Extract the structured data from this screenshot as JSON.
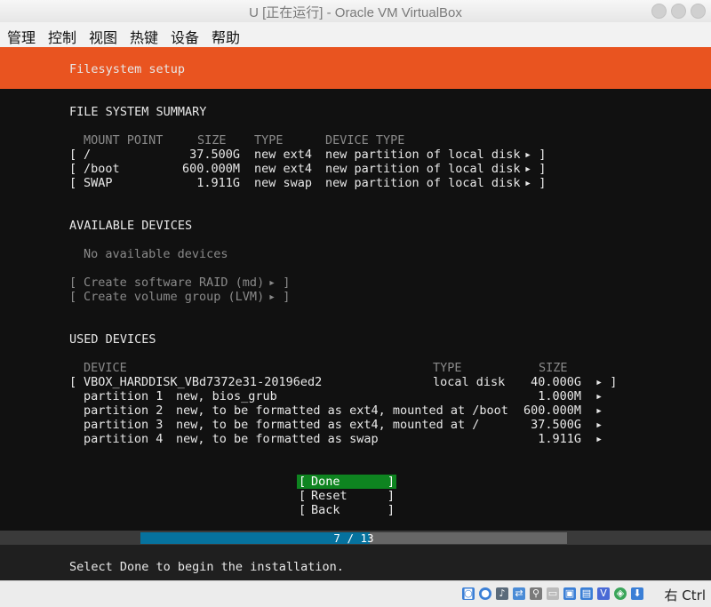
{
  "window": {
    "title": "U [正在运行] - Oracle VM VirtualBox"
  },
  "menubar": {
    "items": [
      "管理",
      "控制",
      "视图",
      "热键",
      "设备",
      "帮助"
    ]
  },
  "installer": {
    "header": "Filesystem setup",
    "summary": {
      "heading": "FILE SYSTEM SUMMARY",
      "columns": [
        "MOUNT POINT",
        "SIZE",
        "TYPE",
        "DEVICE TYPE"
      ],
      "rows": [
        {
          "mount": "/",
          "size": "37.500G",
          "type": "new ext4",
          "device_type": "new partition of local disk"
        },
        {
          "mount": "/boot",
          "size": "600.000M",
          "type": "new ext4",
          "device_type": "new partition of local disk"
        },
        {
          "mount": "SWAP",
          "size": "1.911G",
          "type": "new swap",
          "device_type": "new partition of local disk"
        }
      ]
    },
    "available": {
      "heading": "AVAILABLE DEVICES",
      "empty_text": "No available devices",
      "actions": [
        "Create software RAID (md)",
        "Create volume group (LVM)"
      ]
    },
    "used": {
      "heading": "USED DEVICES",
      "columns": [
        "DEVICE",
        "TYPE",
        "SIZE"
      ],
      "disk": {
        "name": "VBOX_HARDDISK_VBd7372e31-20196ed2",
        "type": "local disk",
        "size": "40.000G"
      },
      "partitions": [
        {
          "label": "partition 1",
          "desc": "new, bios_grub",
          "size": "1.000M"
        },
        {
          "label": "partition 2",
          "desc": "new, to be formatted as ext4, mounted at /boot",
          "size": "600.000M"
        },
        {
          "label": "partition 3",
          "desc": "new, to be formatted as ext4, mounted at /",
          "size": "37.500G"
        },
        {
          "label": "partition 4",
          "desc": "new, to be formatted as swap",
          "size": "1.911G"
        }
      ]
    },
    "buttons": {
      "done": "Done",
      "reset": "Reset",
      "back": "Back"
    },
    "progress": {
      "text": "7 / 13",
      "fraction": 0.538
    },
    "footer": "Select Done to begin the installation."
  },
  "statusbar": {
    "host_key": "右 Ctrl"
  },
  "colors": {
    "accent": "#e95420",
    "done_button": "#0e8420",
    "progress_fill": "#06729e"
  }
}
